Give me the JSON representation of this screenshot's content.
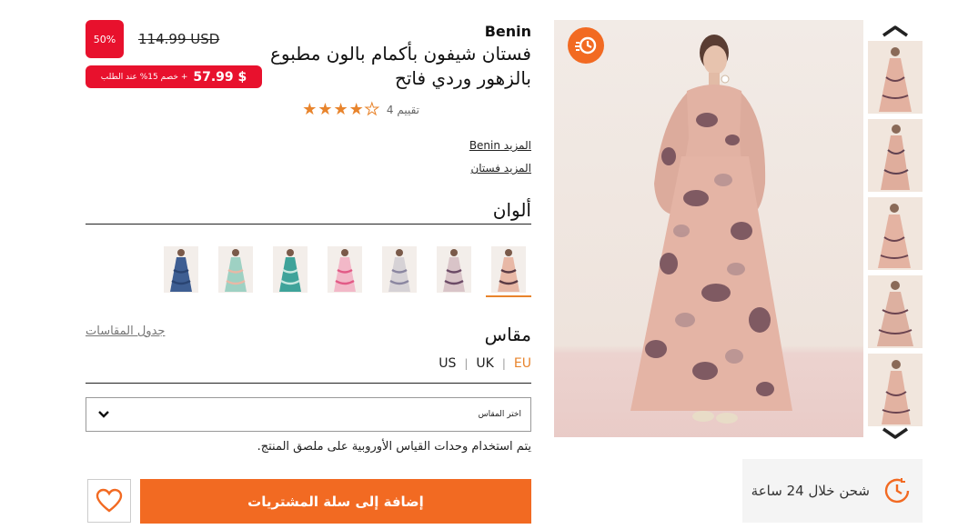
{
  "gallery": {
    "up_icon": "chevron-up-icon",
    "down_icon": "chevron-down-icon",
    "quick_badge_icon": "fast-delivery-icon",
    "thumbnail_count": 5
  },
  "product": {
    "brand": "Benin",
    "title": "فستان شيفون بأكمام بالون مطبوع بالزهور وردي فاتح",
    "rating": 4,
    "rating_max": 5,
    "rating_label": "تقييم 4",
    "more_brand": "المزيد Benin",
    "more_category": "المزيد فستان"
  },
  "pricing": {
    "discount_badge": "50%",
    "old_price": "114.99 USD",
    "promo_price": "57.99 $",
    "promo_text": "+ خصم 15% عند الطلب"
  },
  "colors": {
    "title": "ألوان",
    "swatches": [
      {
        "name": "blush-floral",
        "colors": [
          "#e8b8a6",
          "#5a3a44"
        ]
      },
      {
        "name": "plum-floral",
        "colors": [
          "#d9c4c8",
          "#6b4a66"
        ]
      },
      {
        "name": "grey-print",
        "colors": [
          "#d6d2d6",
          "#8a86a0"
        ]
      },
      {
        "name": "pink-print",
        "colors": [
          "#f2b8c8",
          "#e25a86"
        ]
      },
      {
        "name": "teal-floral",
        "colors": [
          "#3fa39a",
          "#c8e8e0"
        ]
      },
      {
        "name": "mint-pattern",
        "colors": [
          "#9ed1c3",
          "#e8b8a6"
        ]
      },
      {
        "name": "blue-dress",
        "colors": [
          "#3e5e92",
          "#2a4472"
        ]
      }
    ],
    "accent": "#e8842c"
  },
  "size": {
    "title": "مقاس",
    "chart_link": "جدول المقاسات",
    "units": [
      "EU",
      "UK",
      "US"
    ],
    "active_unit": "EU",
    "select_placeholder": "اختر المقاس",
    "note": "يتم استخدام وحدات القياس الأوروبية على ملصق المنتج."
  },
  "actions": {
    "add_to_cart": "إضافة إلى سلة المشتريات",
    "wishlist_icon": "heart-icon"
  },
  "shipping": {
    "text": "شحن خلال 24 ساعة",
    "icon": "clock-icon"
  },
  "theme": {
    "brand_orange": "#f26a22",
    "sale_red": "#e8112d",
    "star_color": "#e8842c"
  }
}
